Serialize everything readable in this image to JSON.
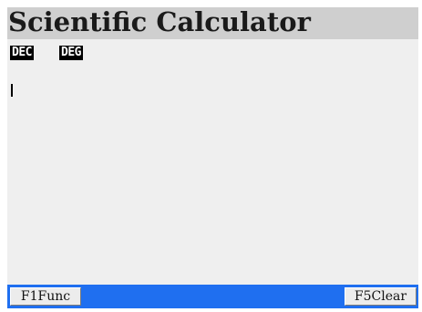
{
  "app": {
    "title": "Scientific Calculator"
  },
  "modes": {
    "number_base": "DEC",
    "angle_unit": "DEG"
  },
  "display": {
    "expression": ""
  },
  "softkeys": {
    "left": {
      "key": "F1",
      "label": "Func"
    },
    "right": {
      "key": "F5",
      "label": "Clear"
    }
  },
  "colors": {
    "title_bar_bg": "#cfcfcf",
    "screen_bg": "#efefef",
    "softkey_bar_bg": "#1f6ff0",
    "badge_bg": "#000000",
    "badge_fg": "#ffffff"
  }
}
